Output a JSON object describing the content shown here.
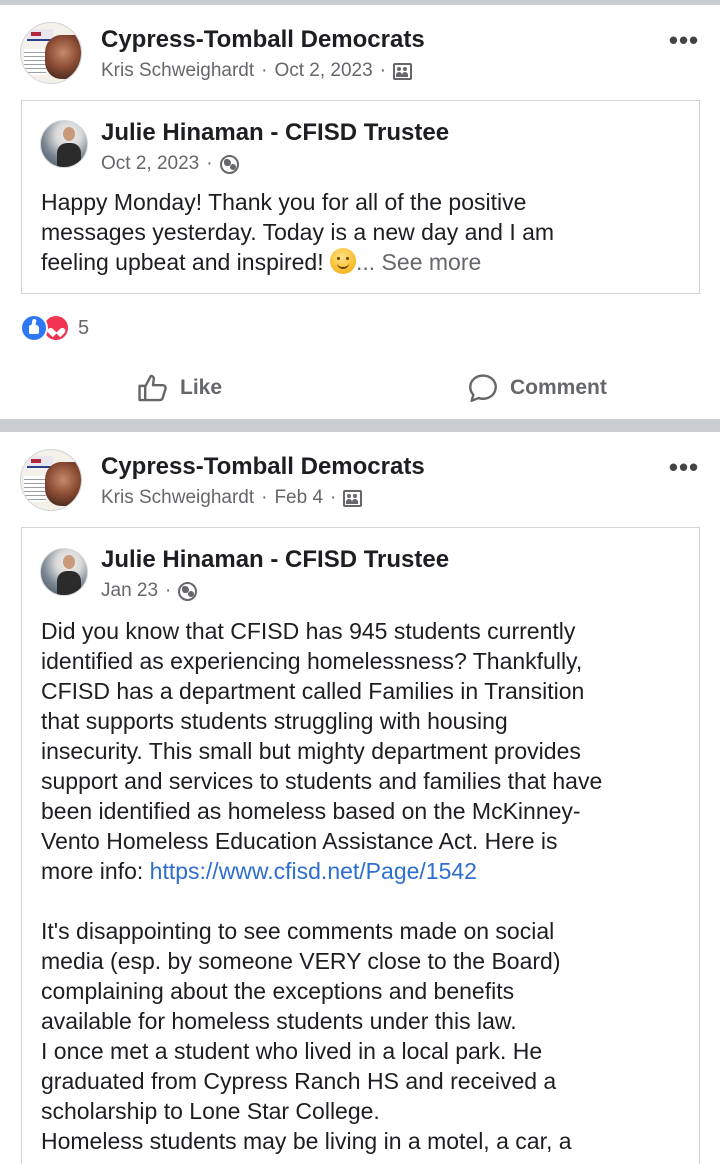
{
  "posts": [
    {
      "page_name": "Cypress-Tomball Democrats",
      "poster": "Kris Schweighardt",
      "date": "Oct 2, 2023",
      "separator": "·",
      "audience_icon": "group-icon",
      "more_label": "•••",
      "shared": {
        "author": "Julie Hinaman - CFISD Trustee",
        "date": "Oct 2, 2023",
        "audience_icon": "globe-icon",
        "text_lines": [
          "Happy Monday! Thank you for all of the positive",
          "messages yesterday.  Today is a new day and I am",
          "feeling upbeat and inspired! "
        ],
        "emoji": "smiling-face-emoji",
        "see_more": "... See more"
      },
      "reactions": {
        "count": "5",
        "types": [
          "like",
          "love"
        ]
      },
      "actions": {
        "like": "Like",
        "comment": "Comment"
      }
    },
    {
      "page_name": "Cypress-Tomball Democrats",
      "poster": "Kris Schweighardt",
      "date": "Feb 4",
      "separator": "·",
      "audience_icon": "group-icon",
      "more_label": "•••",
      "shared": {
        "author": "Julie Hinaman - CFISD Trustee",
        "date": "Jan 23",
        "audience_icon": "globe-icon",
        "text_lines": [
          "Did you know that CFISD has 945 students currently",
          "identified as experiencing homelessness?  Thankfully,",
          "CFISD has a department called Families in Transition",
          "that supports students struggling with housing",
          "insecurity.  This small but mighty department provides",
          "support and services to students and families that have",
          "been identified as homeless based on the McKinney-",
          "Vento Homeless Education Assistance Act.  Here is"
        ],
        "more_info_label": "more info: ",
        "link": "https://www.cfisd.net/Page/1542",
        "text_lines_2": [
          "It's disappointing to see comments made on social",
          "media (esp. by someone VERY close to the Board)",
          "complaining about the exceptions and benefits",
          "available for homeless students under this law.",
          "I once met a student who lived in a local park.  He",
          "graduated from Cypress Ranch HS and received a",
          "scholarship to Lone Star College.",
          "Homeless students may be living in a motel, a car, a"
        ]
      }
    }
  ]
}
